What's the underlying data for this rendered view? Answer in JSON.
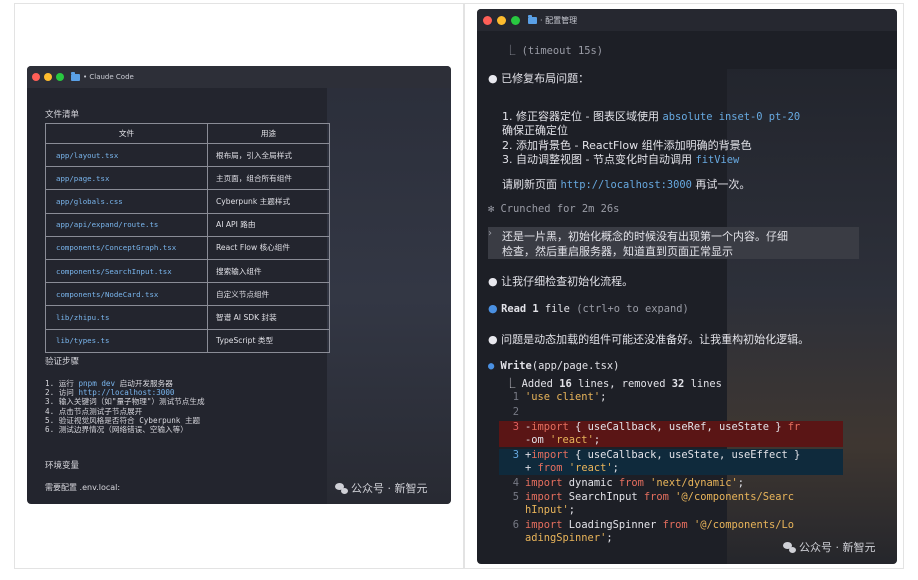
{
  "left_window": {
    "title": "Claude Code",
    "files_heading": "文件清单",
    "table": {
      "headers": [
        "文件",
        "用途"
      ],
      "rows": [
        [
          "app/layout.tsx",
          "根布局，引入全局样式"
        ],
        [
          "app/page.tsx",
          "主页面，组合所有组件"
        ],
        [
          "app/globals.css",
          "Cyberpunk 主题样式"
        ],
        [
          "app/api/expand/route.ts",
          "AI API 路由"
        ],
        [
          "components/ConceptGraph.tsx",
          "React Flow 核心组件"
        ],
        [
          "components/SearchInput.tsx",
          "搜索输入组件"
        ],
        [
          "components/NodeCard.tsx",
          "自定义节点组件"
        ],
        [
          "lib/zhipu.ts",
          "智谱 AI SDK 封装"
        ],
        [
          "lib/types.ts",
          "TypeScript 类型"
        ]
      ]
    },
    "steps_heading": "验证步骤",
    "steps": [
      {
        "pre": "1. 运行 ",
        "hl": "pnpm dev",
        "post": " 启动开发服务器"
      },
      {
        "pre": "2. 访问 ",
        "hl": "http://localhost:3000",
        "post": ""
      },
      {
        "pre": "3. 输入关键词（如\"量子物理\"）测试节点生成",
        "hl": "",
        "post": ""
      },
      {
        "pre": "4. 点击节点测试子节点展开",
        "hl": "",
        "post": ""
      },
      {
        "pre": "5. 验证视觉风格是否符合 Cyberpunk 主题",
        "hl": "",
        "post": ""
      },
      {
        "pre": "6. 测试边界情况（网络错误、空输入等）",
        "hl": "",
        "post": ""
      }
    ],
    "env_heading": "环境变量",
    "env_line": "需要配置 .env.local:",
    "watermark": "公众号 · 新智元"
  },
  "right_window": {
    "title": "· 配置管理",
    "timeout_line": "⎿  (timeout 15s)",
    "fixed_heading": "已修复布局问题：",
    "fixes": [
      {
        "pre": "1. 修正容器定位 - 图表区域使用 ",
        "hl": "absolute inset-0 pt-20",
        "post": ""
      },
      {
        "pre": "确保正确定位",
        "hl": "",
        "post": ""
      },
      {
        "pre": "2. 添加背景色 - ReactFlow 组件添加明确的背景色",
        "hl": "",
        "post": ""
      },
      {
        "pre": "3. 自动调整视图 - 节点变化时自动调用 ",
        "hl": "fitView",
        "post": ""
      }
    ],
    "refresh": {
      "pre": "请刷新页面 ",
      "hl": "http://localhost:3000",
      "post": " 再试一次。"
    },
    "crunched": "✻ Crunched for 2m 26s",
    "user_msg_1": "还是一片黑，初始化概念的时候没有出现第一个内容。仔细",
    "user_msg_2": "检查，然后重启服务器，知道直到页面正常显示",
    "check_line": "让我仔细检查初始化流程。",
    "read_line": {
      "label": "Read ",
      "count": "1",
      "rest": " file ",
      "hint": "(ctrl+o to expand)"
    },
    "problem_line": "问题是动态加载的组件可能还没准备好。让我重构初始化逻辑。",
    "write_line": {
      "label": "Write",
      "arg": "(app/page.tsx)"
    },
    "added_line": {
      "pre": "⎿  Added ",
      "n1": "16",
      "mid": " lines, removed ",
      "n2": "32",
      "post": " lines"
    },
    "watermark": "公众号 · 新智元",
    "colors": {
      "removed_bg": "#5a1515",
      "added_bg": "#0f2a3c",
      "accent": "#67a9e0"
    }
  }
}
